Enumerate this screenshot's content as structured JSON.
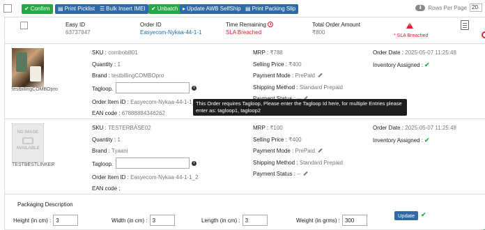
{
  "toolbar": {
    "buttons": [
      {
        "label": "Confirm",
        "icon": "check-icon",
        "color": "#28a745"
      },
      {
        "label": "Print Picklist",
        "icon": "print-icon",
        "color": "#2f6aa7"
      },
      {
        "label": "Bulk Insert IMEI",
        "icon": "list-icon",
        "color": "#2f6aa7"
      },
      {
        "label": "Unbatch",
        "icon": "check-icon",
        "color": "#28a745"
      },
      {
        "label": "Update AWB SelfShip",
        "icon": "truck-icon",
        "color": "#2f6aa7"
      },
      {
        "label": "Print Packing Slip",
        "icon": "print-icon",
        "color": "#2f6aa7"
      }
    ],
    "rows_per_page_label": "Rows Per Page",
    "rows_per_page_value": "20"
  },
  "order": {
    "easy_id_label": "Easy ID",
    "easy_id": "63737847",
    "order_id_label": "Order ID",
    "order_id": "Easyecom-Nykaa-44-1-1",
    "time_remaining_label": "Time Remaining",
    "time_remaining": "SLA Breached",
    "total_label": "Total Order Amount",
    "total": "₹800",
    "sla_warning": "* SLA Breached"
  },
  "items": [
    {
      "image_caption": "testbillingCOMBOpro",
      "sku_label": "SKU :",
      "sku": "combobill01",
      "quantity_label": "Quantity :",
      "quantity": "1",
      "brand_label": "Brand :",
      "brand": "testbillingCOMBOpro",
      "tagloop_label": "Tagloop.",
      "order_item_id_label": "Order Item ID :",
      "order_item_id": "Easyecom-Nykaa-44-1-1_1",
      "ean_label": "EAN code :",
      "ean": "67888884346262",
      "mrp_label": "MRP :",
      "mrp": "₹788",
      "selling_price_label": "Selling Price :",
      "selling_price": "₹400",
      "payment_mode_label": "Payment Mode :",
      "payment_mode": "PrePaid",
      "shipping_method_label": "Shipping Method :",
      "shipping_method": "Standard Prepaid",
      "payment_status_label": "Payment Status :",
      "payment_status": "--",
      "order_date_label": "Order Date :",
      "order_date": "2025-05-07 11:25:48",
      "inventory_label": "Inventory Assigned :"
    },
    {
      "image_caption": "TESTBESTLINKER",
      "noimage_line1": "NO IMAGE",
      "noimage_line2": "AVAILABLE",
      "sku_label": "SKU :",
      "sku": "TESTERBASE02",
      "quantity_label": "Quantity :",
      "quantity": "1",
      "brand_label": "Brand :",
      "brand": "Tyaani",
      "tagloop_label": "Tagloop.",
      "order_item_id_label": "Order Item ID :",
      "order_item_id": "Easyecom-Nykaa-44-1-1_2",
      "ean_label": "EAN code :",
      "ean": "",
      "mrp_label": "MRP :",
      "mrp": "₹100",
      "selling_price_label": "Selling Price :",
      "selling_price": "₹400",
      "payment_mode_label": "Payment Mode :",
      "payment_mode": "PrePaid",
      "shipping_method_label": "Shipping Method :",
      "shipping_method": "Standard Prepaid",
      "payment_status_label": "Payment Status :",
      "payment_status": "--",
      "order_date_label": "Order Date :",
      "order_date": "2025-05-07 11:25:48",
      "inventory_label": "Inventory Assigned :"
    }
  ],
  "tooltip": {
    "text": "This Order requires Tagloop, Please enter the Tagloop Id here, for multiple Entries please enter as: tagloop1, tagloop2"
  },
  "packaging": {
    "title": "Packaging Description",
    "height_label": "Height (in cm) :",
    "height": "3",
    "width_label": "Width (in cm) :",
    "width": "3",
    "length_label": "Length (in cm) :",
    "length": "3",
    "weight_label": "Weight (in grms) :",
    "weight": "300",
    "update_label": "Update"
  }
}
